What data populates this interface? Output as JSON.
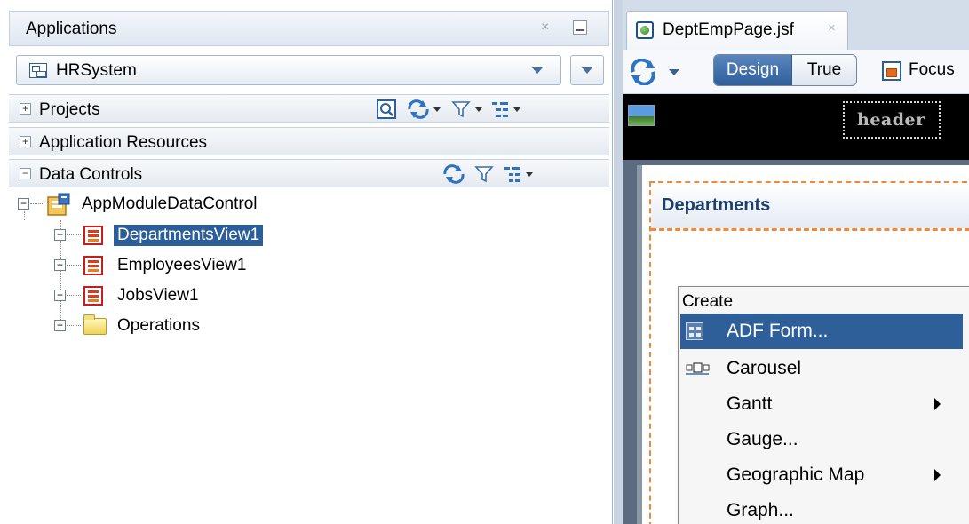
{
  "left_panel": {
    "header_title": "Applications",
    "close_glyph": "×",
    "app_combo_value": "HRSystem",
    "sections": {
      "projects": "Projects",
      "app_resources": "Application Resources",
      "data_controls": "Data Controls"
    },
    "expander_collapsed": "+",
    "expander_expanded": "−",
    "tree": {
      "root": "AppModuleDataControl",
      "items": [
        "DepartmentsView1",
        "EmployeesView1",
        "JobsView1",
        "Operations"
      ],
      "selected": "DepartmentsView1"
    }
  },
  "right_panel": {
    "tab_label": "DeptEmpPage.jsf",
    "tab_close_glyph": "×",
    "mode_design": "Design",
    "mode_true": "True",
    "focus_label": "Focus",
    "header_facet": "header",
    "panel_title": "Departments"
  },
  "context_menu": {
    "title": "Create",
    "items": [
      {
        "label": "ADF Form...",
        "highlighted": true,
        "submenu": false,
        "icon": "form-icon"
      },
      {
        "label": "Carousel",
        "highlighted": false,
        "submenu": false,
        "icon": "carousel-icon"
      },
      {
        "label": "Gantt",
        "highlighted": false,
        "submenu": true
      },
      {
        "label": "Gauge...",
        "highlighted": false,
        "submenu": false
      },
      {
        "label": "Geographic Map",
        "highlighted": false,
        "submenu": true
      },
      {
        "label": "Graph...",
        "highlighted": false,
        "submenu": false
      }
    ]
  },
  "colors": {
    "selection": "#2c5e99",
    "menu_highlight": "#2f5f99",
    "facet_dashed": "#f08a3a",
    "dept_title": "#1c3f6c"
  }
}
